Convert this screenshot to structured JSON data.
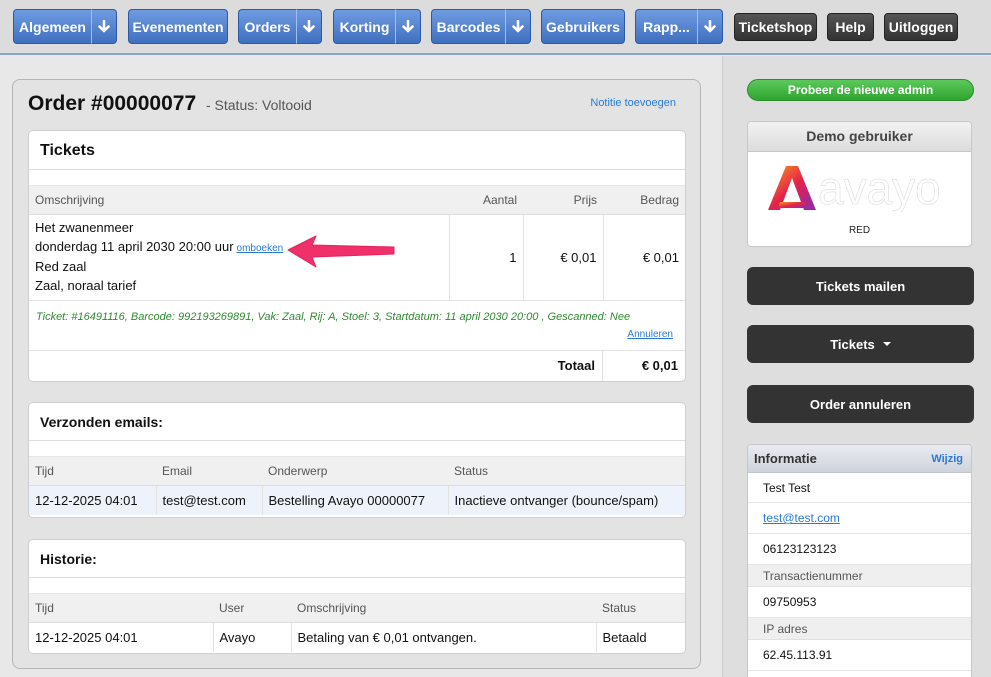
{
  "nav": {
    "algemeen": "Algemeen",
    "evenementen": "Evenementen",
    "orders": "Orders",
    "korting": "Korting",
    "barcodes": "Barcodes",
    "gebruikers": "Gebruikers",
    "rapportages": "Rapp...",
    "ticketshop": "Ticketshop",
    "help": "Help",
    "uitloggen": "Uitloggen"
  },
  "order": {
    "title": "Order #00000077",
    "status": "- Status: Voltooid",
    "note_link": "Notitie toevoegen"
  },
  "tickets": {
    "title": "Tickets",
    "headers": {
      "desc": "Omschrijving",
      "qty": "Aantal",
      "price": "Prijs",
      "amount": "Bedrag"
    },
    "item": {
      "line1": "Het zwanenmeer",
      "line2": "donderdag 11 april 2030 20:00 uur",
      "rebook": "omboeken",
      "line3": "Red zaal",
      "line4": "Zaal, noraal tarief",
      "qty": "1",
      "price": "€ 0,01",
      "amount": "€ 0,01"
    },
    "ticket_info": "Ticket: #16491116, Barcode: 992193269891, Vak: Zaal, Rij: A, Stoel: 3, Startdatum: 11 april 2030 20:00 , Gescanned: Nee",
    "cancel": "Annuleren",
    "total_label": "Totaal",
    "total_value": "€ 0,01"
  },
  "emails": {
    "title": "Verzonden emails:",
    "headers": {
      "time": "Tijd",
      "email": "Email",
      "subject": "Onderwerp",
      "status": "Status"
    },
    "rows": [
      {
        "time": "12-12-2025 04:01",
        "email": "test@test.com",
        "subject": "Bestelling Avayo 00000077",
        "status": "Inactieve ontvanger (bounce/spam)"
      }
    ]
  },
  "history": {
    "title": "Historie:",
    "headers": {
      "time": "Tijd",
      "user": "User",
      "desc": "Omschrijving",
      "status": "Status"
    },
    "rows": [
      {
        "time": "12-12-2025 04:01",
        "user": "Avayo",
        "desc": "Betaling van € 0,01 ontvangen.",
        "status": "Betaald"
      }
    ]
  },
  "sidebar": {
    "new_admin": "Probeer de nieuwe admin",
    "demo_title": "Demo gebruiker",
    "logo_text": "avayo",
    "demo_label": "RED",
    "mail_tickets": "Tickets mailen",
    "tickets": "Tickets",
    "cancel_order": "Order annuleren",
    "info": {
      "title": "Informatie",
      "edit": "Wijzig",
      "name": "Test Test",
      "email": "test@test.com",
      "phone": "06123123123",
      "transaction_label": "Transactienummer",
      "transaction": "09750953",
      "ip_label": "IP adres",
      "ip": "62.45.113.91"
    }
  },
  "colors": {
    "nav_blue": "#4a7cc9",
    "dark_button": "#333333",
    "green_button": "#3cb33c",
    "link": "#2a7bd2",
    "ticket_info": "#2f8a2f",
    "annotation_arrow": "#f0306a"
  }
}
